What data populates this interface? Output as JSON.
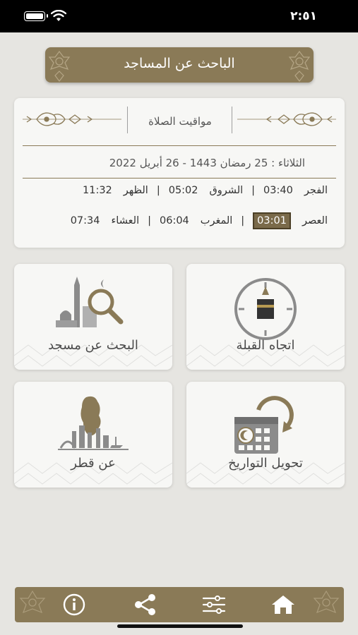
{
  "status": {
    "time": "٢:٥١"
  },
  "header": {
    "title": "الباحث عن المساجد"
  },
  "prayer_card": {
    "title": "مواقيت الصلاة",
    "date_line": "الثلاثاء : 25 رمضان 1443 - 26 أبريل 2022",
    "row1": [
      {
        "name": "الفجر",
        "time": "03:40"
      },
      {
        "name": "الشروق",
        "time": "05:02"
      },
      {
        "name": "الظهر",
        "time": "11:32"
      }
    ],
    "row2": [
      {
        "name": "العصر",
        "time": "03:01",
        "active": true
      },
      {
        "name": "المغرب",
        "time": "06:04"
      },
      {
        "name": "العشاء",
        "time": "07:34"
      }
    ]
  },
  "tiles": {
    "qibla": {
      "label": "اتجاه القبلة",
      "icon": "compass-kaaba-icon"
    },
    "mosque_search": {
      "label": "البحث عن مسجد",
      "icon": "mosque-search-icon"
    },
    "date_convert": {
      "label": "تحويل التواريخ",
      "icon": "calendar-convert-icon"
    },
    "about_qatar": {
      "label": "عن قطر",
      "icon": "qatar-map-icon"
    }
  },
  "bottom_bar": {
    "items": [
      "home-icon",
      "settings-icon",
      "share-icon",
      "info-icon"
    ]
  },
  "colors": {
    "gold": "#8a7a57",
    "background": "#e6e5e1",
    "card": "#f7f7f5",
    "active_time": "#7a6a4a"
  }
}
